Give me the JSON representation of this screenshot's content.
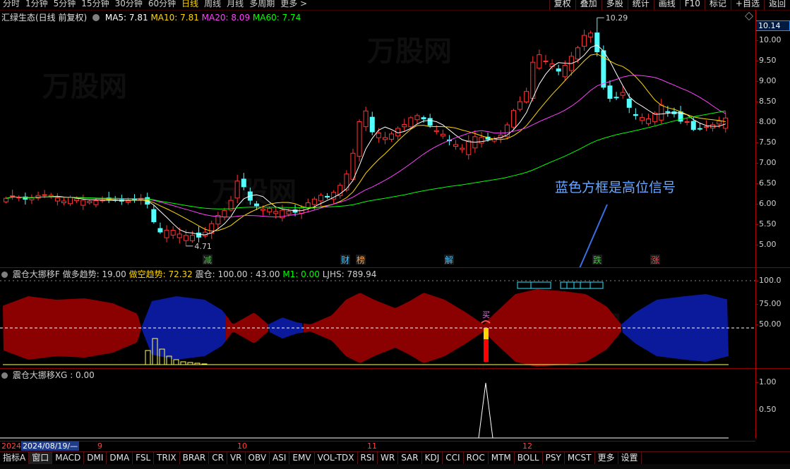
{
  "toolbar": {
    "periods": [
      "分时",
      "1分钟",
      "5分钟",
      "15分钟",
      "30分钟",
      "60分钟",
      "日线",
      "周线",
      "月线",
      "多周期",
      "更多 >"
    ],
    "active_period": "日线",
    "right_buttons": [
      "复权",
      "叠加",
      "多股",
      "统计",
      "画线",
      "F10",
      "标记",
      "+自选",
      "返回"
    ]
  },
  "main": {
    "title": "汇绿生态(日线 前复权)",
    "ma": [
      {
        "label": "MA5: 7.81",
        "color": "#ffffff"
      },
      {
        "label": "MA10: 7.81",
        "color": "#ffd700"
      },
      {
        "label": "MA20: 8.09",
        "color": "#ff40ff"
      },
      {
        "label": "MA60: 7.74",
        "color": "#00ff00"
      }
    ],
    "price_box": "10.14",
    "high_label": "10.29",
    "low_label": "4.71",
    "annotation": "蓝色方框是高位信号",
    "y_ticks": [
      "10.00",
      "9.50",
      "9.00",
      "8.50",
      "8.00",
      "7.50",
      "7.00",
      "6.50",
      "6.00",
      "5.50",
      "5.00"
    ],
    "events": [
      {
        "label": "减",
        "color": "#40c040"
      },
      {
        "label": "财",
        "color": "#40c0ff"
      },
      {
        "label": "榜",
        "color": "#ffa040"
      },
      {
        "label": "解",
        "color": "#40c0ff"
      },
      {
        "label": "跌",
        "color": "#40c040"
      },
      {
        "label": "涨",
        "color": "#ff4040"
      }
    ]
  },
  "indicator1": {
    "name": "震仓大挪移F",
    "items": [
      {
        "label": "做多趋势: 19.00",
        "color": "#d0d0d0"
      },
      {
        "label": "做空趋势: 72.32",
        "color": "#ffd700"
      },
      {
        "label": "震仓: 100.00",
        "color": "#d0d0d0"
      },
      {
        "label": ": 43.00",
        "color": "#d0d0d0"
      },
      {
        "label": "M1: 0.00",
        "color": "#00ff00"
      },
      {
        "label": "LJHS: 789.94",
        "color": "#d0d0d0"
      }
    ],
    "y_ticks": [
      "100.0",
      "75.00",
      "50.00"
    ],
    "buy_label": "买"
  },
  "indicator2": {
    "name": "震仓大挪移XG",
    "value": ": 0.00",
    "y_ticks": [
      "1.00",
      "0.50"
    ]
  },
  "dates": {
    "year": "2024",
    "cursor_date": "2024/08/19/—",
    "months": [
      "9",
      "10",
      "11",
      "12"
    ]
  },
  "tabs": {
    "items": [
      "指标A",
      "窗口",
      "MACD",
      "DMI",
      "DMA",
      "FSL",
      "TRIX",
      "BRAR",
      "CR",
      "VR",
      "OBV",
      "ASI",
      "EMV",
      "VOL-TDX",
      "RSI",
      "WR",
      "SAR",
      "KDJ",
      "CCI",
      "ROC",
      "MTM",
      "BOLL",
      "PSY",
      "MCST",
      "更多",
      "设置"
    ],
    "active": "窗口"
  },
  "watermark": "万股网"
}
